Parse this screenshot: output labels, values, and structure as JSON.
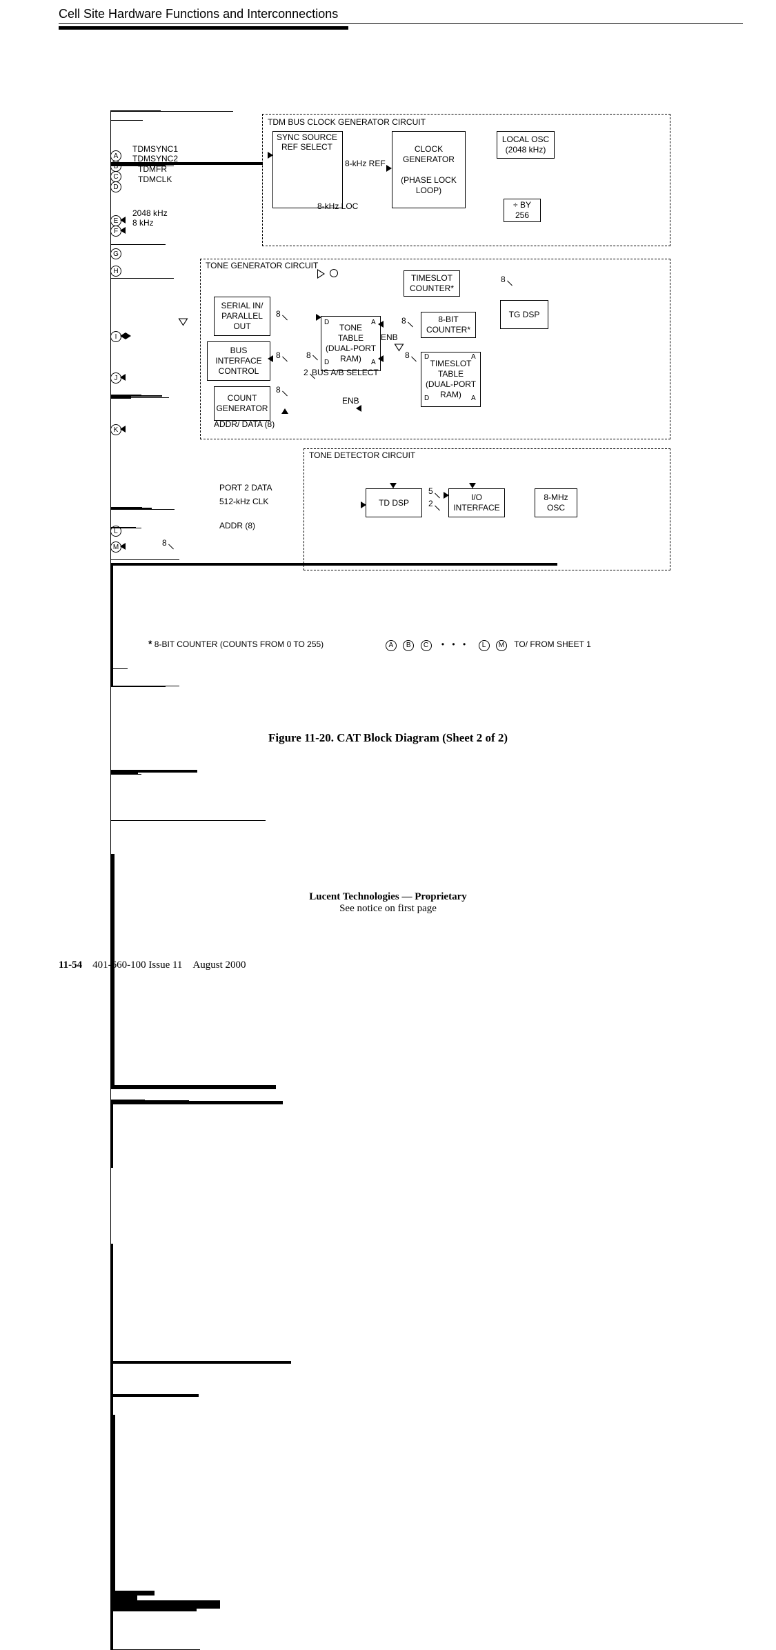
{
  "header": {
    "title": "Cell Site Hardware Functions and Interconnections"
  },
  "caption": "Figure 11-20.  CAT Block Diagram (Sheet 2 of 2)",
  "proprietary_line1": "Lucent Technologies — Proprietary",
  "proprietary_line2": "See notice on first page",
  "footer": {
    "page_num": "11-54",
    "doc": "401-660-100 Issue 11",
    "date": "August 2000"
  },
  "signals": {
    "A": "TDMSYNC1",
    "B": "TDMSYNC2",
    "C": "TDMFR",
    "D": "TDMCLK",
    "E": "2048 kHz",
    "F": "8 kHz",
    "G": "",
    "H": "",
    "I": "",
    "J": "",
    "K": "",
    "L": "",
    "M": ""
  },
  "section_titles": {
    "tdm": "TDM BUS CLOCK GENERATOR CIRCUIT",
    "tone_gen": "TONE GENERATOR CIRCUIT",
    "tone_det": "TONE DETECTOR CIRCUIT"
  },
  "blocks": {
    "sync_sel": "SYNC SOURCE\nREF SELECT",
    "clock_gen": "CLOCK\nGENERATOR\n\n(PHASE LOCK\nLOOP)",
    "local_osc": "LOCAL OSC\n(2048 kHz)",
    "div256": "÷ BY\n256",
    "serial_in": "SERIAL IN/\nPARALLEL\nOUT",
    "bus_if": "BUS\nINTERFACE\nCONTROL",
    "count_gen": "COUNT\nGENERATOR",
    "tone_table": "TONE\nTABLE\n(DUAL-PORT\nRAM)",
    "timeslot_counter": "TIMESLOT\nCOUNTER*",
    "eight_bit_counter": "8-BIT\nCOUNTER*",
    "timeslot_table": "TIMESLOT\nTABLE\n(DUAL-PORT\nRAM)",
    "tg_dsp": "TG DSP",
    "td_dsp": "TD DSP",
    "io_if": "I/O\nINTERFACE",
    "osc8": "8-MHz\nOSC"
  },
  "labels": {
    "khz_ref": "8-kHz REF",
    "khz_loc": "8-kHz LOC",
    "bus_ab_sel": "BUS A/B SELECT",
    "enb": "ENB",
    "addr_data8": "ADDR/ DATA (8)",
    "port2": "PORT 2 DATA",
    "clk512": "512-kHz CLK",
    "addr8": "ADDR (8)",
    "d": "D",
    "a": "A",
    "eight": "8",
    "five": "5",
    "two": "2"
  },
  "footnote": {
    "star": "*",
    "text": "8-BIT COUNTER (COUNTS FROM 0 TO 255)",
    "legend_letters": [
      "A",
      "B",
      "C",
      "L",
      "M"
    ],
    "legend_ellipsis": "• • •",
    "legend_text": "TO/ FROM SHEET 1"
  }
}
